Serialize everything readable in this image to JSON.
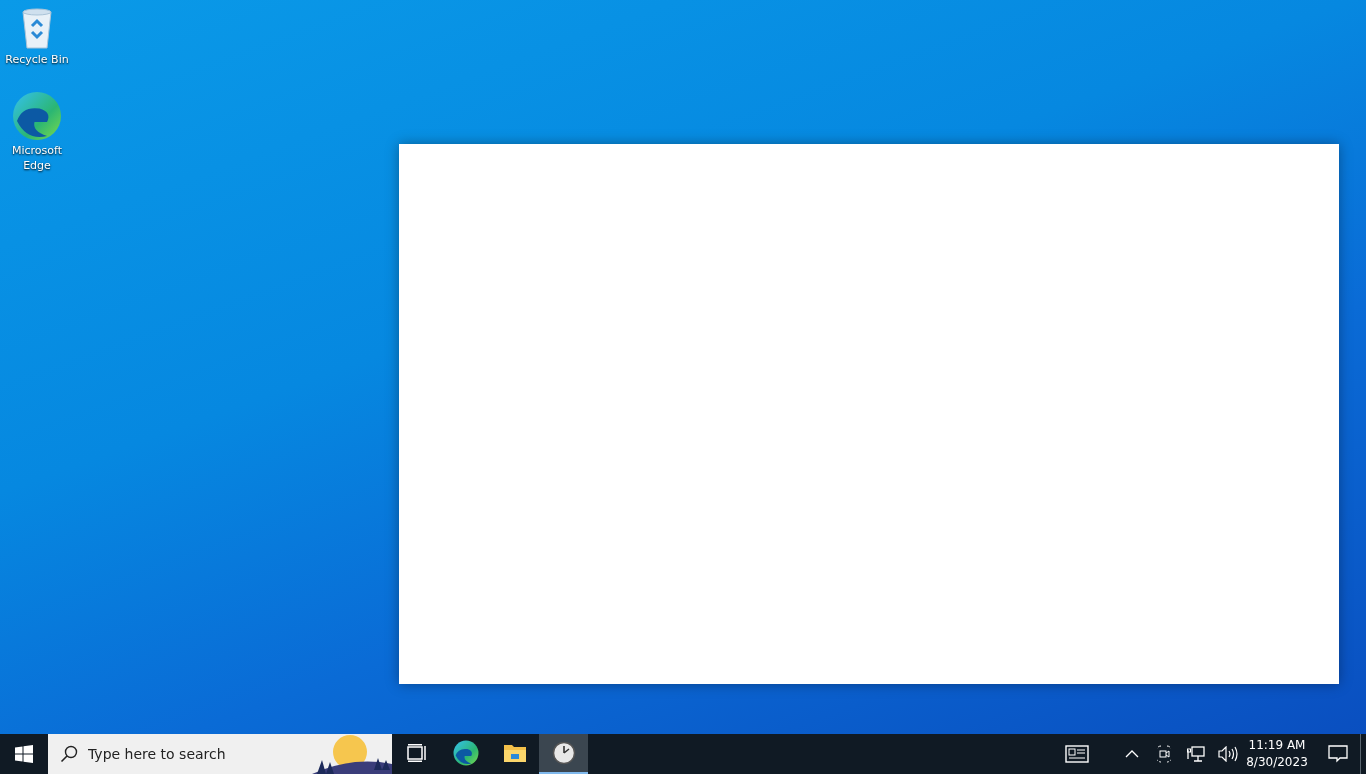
{
  "desktop_icons": [
    {
      "label": "Recycle Bin",
      "kind": "recycle"
    },
    {
      "label": "Microsoft Edge",
      "kind": "edge"
    }
  ],
  "window": {
    "kind": "blank"
  },
  "taskbar": {
    "search": {
      "placeholder": "Type here to search"
    },
    "apps": [
      {
        "kind": "taskview",
        "selected": false
      },
      {
        "kind": "edge",
        "selected": false
      },
      {
        "kind": "folder",
        "selected": false
      },
      {
        "kind": "clock",
        "selected": true
      }
    ],
    "tray": {
      "time": "11:19 AM",
      "date": "8/30/2023"
    }
  }
}
